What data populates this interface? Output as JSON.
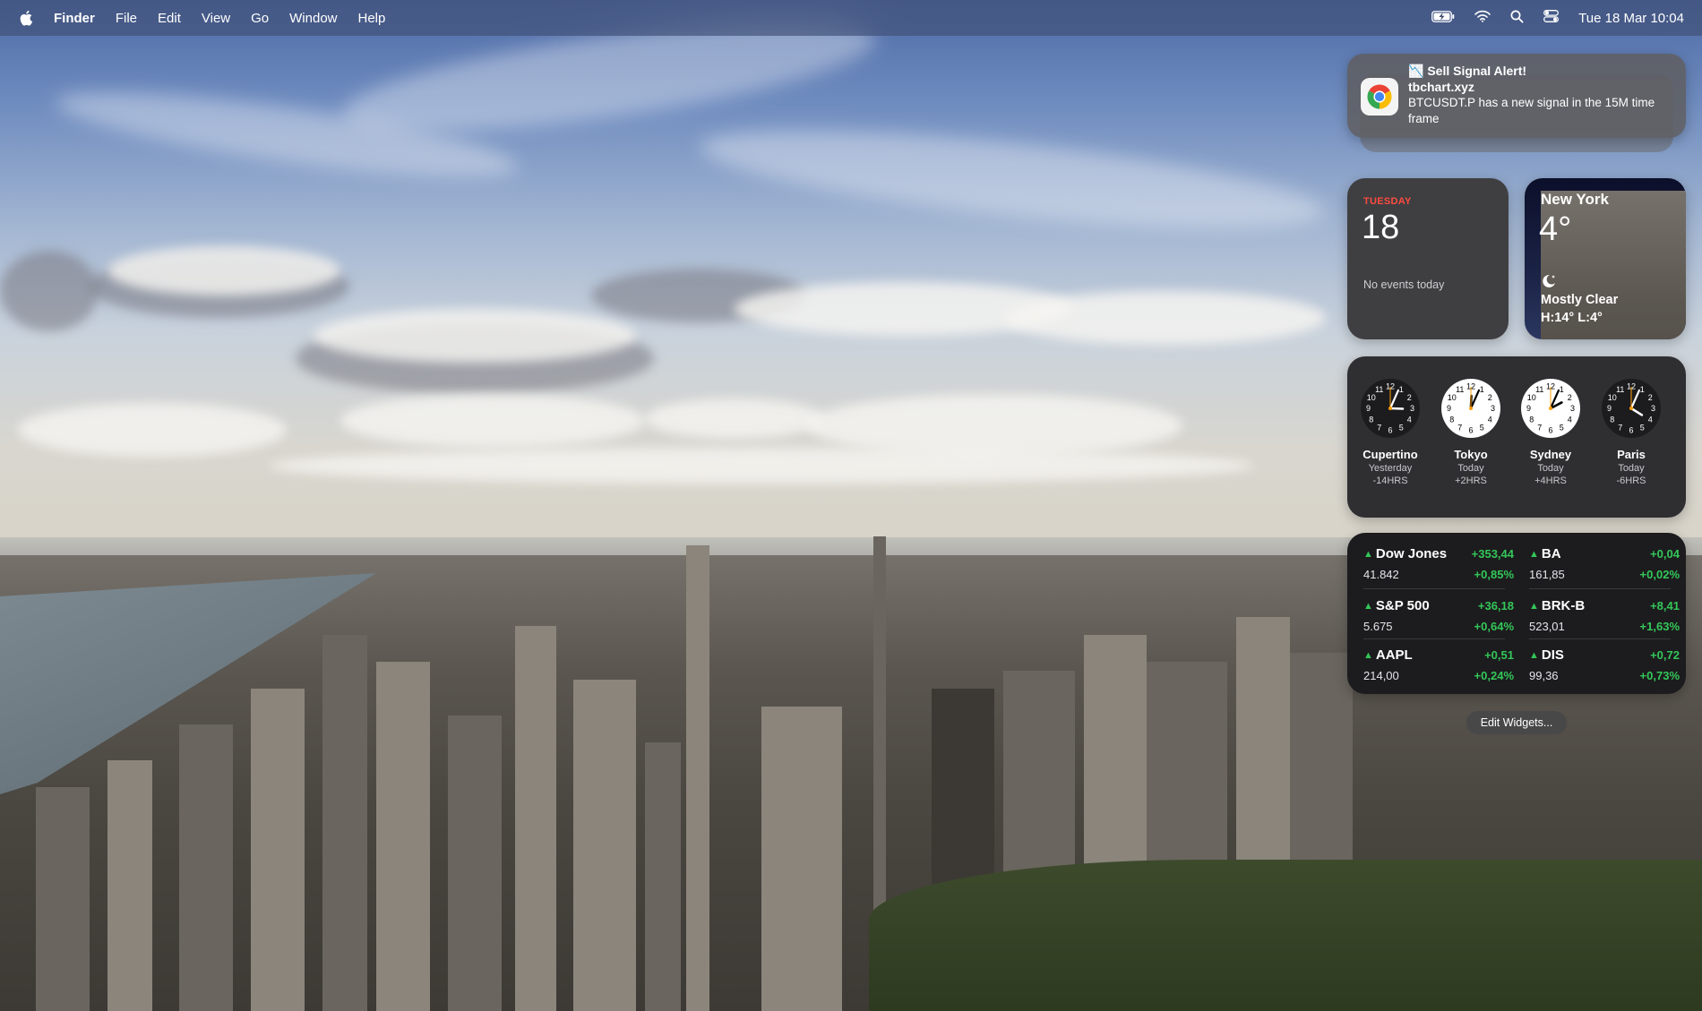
{
  "menubar": {
    "app_name": "Finder",
    "menus": [
      "File",
      "Edit",
      "View",
      "Go",
      "Window",
      "Help"
    ],
    "status_icons": [
      "battery-charging-icon",
      "wifi-icon",
      "search-icon",
      "control-center-icon"
    ],
    "clock": "Tue 18 Mar  10:04"
  },
  "notification": {
    "title": "📉 Sell Signal Alert!",
    "subtitle": "tbchart.xyz",
    "body": "BTCUSDT.P has a new signal in the 15M time frame",
    "app_icon": "chrome-icon"
  },
  "calendar_widget": {
    "weekday": "TUESDAY",
    "date": "18",
    "events": "No events today"
  },
  "weather_widget": {
    "city": "New York",
    "temperature": "4°",
    "condition_icon": "moon-icon",
    "condition": "Mostly Clear",
    "high_low": "H:14° L:4°"
  },
  "world_clock_widget": {
    "clocks": [
      {
        "city": "Cupertino",
        "day": "Yesterday",
        "offset": "-14HRS",
        "hour": 15,
        "minute": 4,
        "dark": true
      },
      {
        "city": "Tokyo",
        "day": "Today",
        "offset": "+2HRS",
        "hour": 12,
        "minute": 4,
        "dark": false
      },
      {
        "city": "Sydney",
        "day": "Today",
        "offset": "+4HRS",
        "hour": 14,
        "minute": 4,
        "dark": false
      },
      {
        "city": "Paris",
        "day": "Today",
        "offset": "-6HRS",
        "hour": 4,
        "minute": 4,
        "dark": true
      }
    ]
  },
  "stocks_widget": {
    "up_color": "#34c759",
    "stocks": [
      {
        "symbol": "Dow Jones",
        "change": "+353,44",
        "price": "41.842",
        "percent": "+0,85%"
      },
      {
        "symbol": "BA",
        "change": "+0,04",
        "price": "161,85",
        "percent": "+0,02%"
      },
      {
        "symbol": "S&P 500",
        "change": "+36,18",
        "price": "5.675",
        "percent": "+0,64%"
      },
      {
        "symbol": "BRK-B",
        "change": "+8,41",
        "price": "523,01",
        "percent": "+1,63%"
      },
      {
        "symbol": "AAPL",
        "change": "+0,51",
        "price": "214,00",
        "percent": "+0,24%"
      },
      {
        "symbol": "DIS",
        "change": "+0,72",
        "price": "99,36",
        "percent": "+0,73%"
      }
    ]
  },
  "edit_widgets_label": "Edit Widgets..."
}
